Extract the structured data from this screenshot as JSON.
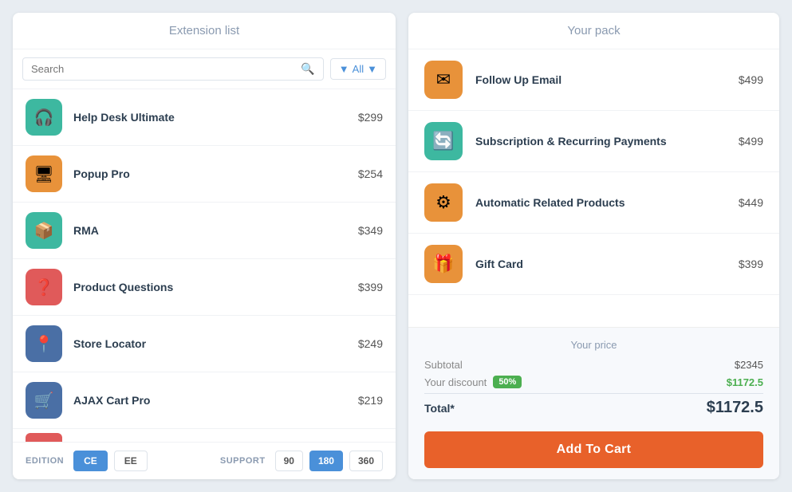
{
  "left_panel": {
    "title": "Extension list",
    "search_placeholder": "Search",
    "filter_label": "All",
    "extensions": [
      {
        "id": "help-desk",
        "name": "Help Desk Ultimate",
        "price": "$299",
        "icon_bg": "#3db8a0",
        "icon": "🎧"
      },
      {
        "id": "popup-pro",
        "name": "Popup Pro",
        "price": "$254",
        "icon_bg": "#e8923a",
        "icon": "🖥"
      },
      {
        "id": "rma",
        "name": "RMA",
        "price": "$349",
        "icon_bg": "#3db8a0",
        "icon": "📦"
      },
      {
        "id": "product-questions",
        "name": "Product Questions",
        "price": "$399",
        "icon_bg": "#e05a5a",
        "icon": "❓"
      },
      {
        "id": "store-locator",
        "name": "Store Locator",
        "price": "$249",
        "icon_bg": "#4a6fa5",
        "icon": "📍"
      },
      {
        "id": "ajax-cart-pro",
        "name": "AJAX Cart Pro",
        "price": "$219",
        "icon_bg": "#4a6fa5",
        "icon": "🛒"
      }
    ],
    "edition_label": "EDITION",
    "edition_buttons": [
      {
        "label": "CE",
        "active": true
      },
      {
        "label": "EE",
        "active": false
      }
    ],
    "support_label": "SUPPORT",
    "support_buttons": [
      {
        "label": "90",
        "active": false
      },
      {
        "label": "180",
        "active": true
      },
      {
        "label": "360",
        "active": false
      }
    ]
  },
  "right_panel": {
    "title": "Your pack",
    "items": [
      {
        "id": "follow-up-email",
        "name": "Follow Up Email",
        "price": "$499",
        "icon_bg": "#e8923a",
        "icon": "✉"
      },
      {
        "id": "subscription-recurring",
        "name": "Subscription & Recurring Payments",
        "price": "$499",
        "icon_bg": "#3db8a0",
        "icon": "🔄"
      },
      {
        "id": "automatic-related",
        "name": "Automatic Related Products",
        "price": "$449",
        "icon_bg": "#e8923a",
        "icon": "⚙"
      },
      {
        "id": "gift-card",
        "name": "Gift Card",
        "price": "$399",
        "icon_bg": "#e8923a",
        "icon": "🎁"
      }
    ],
    "price_section_title": "Your price",
    "subtotal_label": "Subtotal",
    "subtotal_value": "$2345",
    "discount_label": "Your discount",
    "discount_badge": "50%",
    "discount_value": "$1172.5",
    "total_label": "Total*",
    "total_value": "$1172.5",
    "add_to_cart_label": "Add To Cart"
  }
}
